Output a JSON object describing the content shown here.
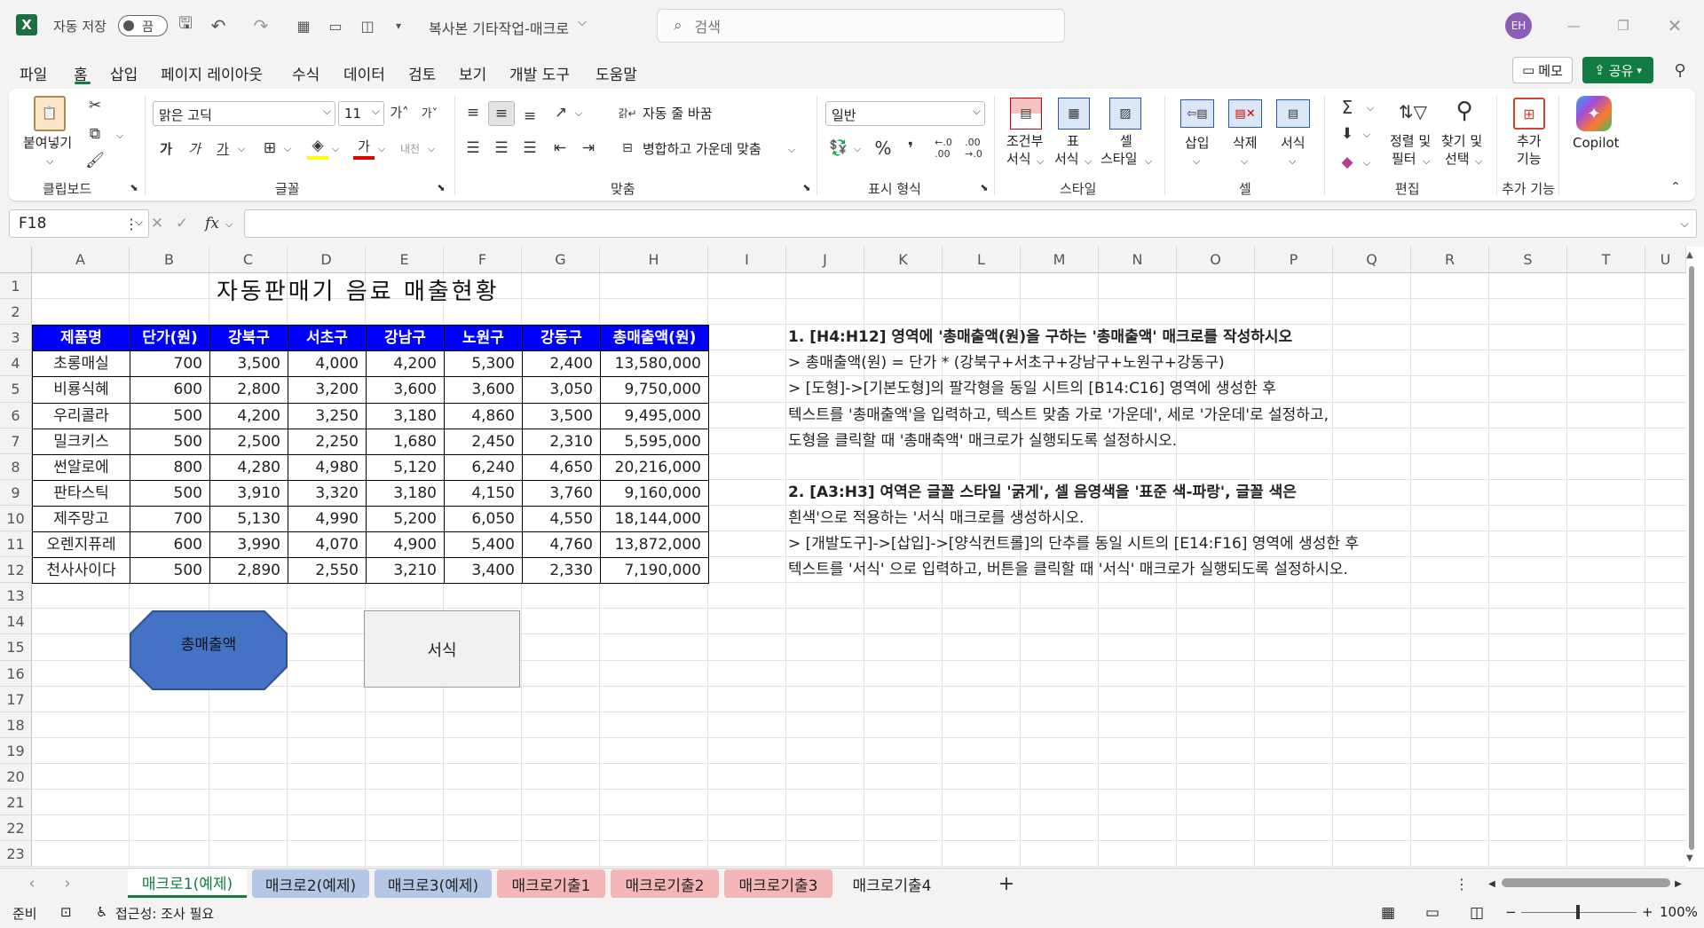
{
  "titlebar": {
    "autosave_label": "자동 저장",
    "autosave_state": "끔",
    "doc_title": "복사본 기타작업-매크로",
    "search_placeholder": "검색",
    "avatar_initials": "EH"
  },
  "menu": {
    "items": [
      "파일",
      "홈",
      "삽입",
      "페이지 레이아웃",
      "수식",
      "데이터",
      "검토",
      "보기",
      "개발 도구",
      "도움말"
    ],
    "memo_label": "메모",
    "share_label": "공유"
  },
  "ribbon": {
    "clipboard": {
      "paste": "붙여넣기",
      "group": "클립보드"
    },
    "font": {
      "name": "맑은 고딕",
      "size": "11",
      "group": "글꼴"
    },
    "align": {
      "wrap": "자동 줄 바꿈",
      "merge": "병합하고 가운데 맞춤",
      "group": "맞춤"
    },
    "number": {
      "format": "일반",
      "group": "표시 형식"
    },
    "style": {
      "cond": "조건부",
      "cond2": "서식",
      "table": "표",
      "table2": "서식",
      "cell": "셀",
      "cell2": "스타일",
      "group": "스타일"
    },
    "cells": {
      "insert": "삽입",
      "delete": "삭제",
      "format": "서식",
      "group": "셀"
    },
    "edit": {
      "sort": "정렬 및",
      "sort2": "필터",
      "find": "찾기 및",
      "find2": "선택",
      "group": "편집"
    },
    "addin": {
      "label": "추가",
      "label2": "기능",
      "group": "추가 기능"
    },
    "copilot": "Copilot"
  },
  "formula": {
    "namebox": "F18",
    "value": ""
  },
  "columns": [
    "A",
    "B",
    "C",
    "D",
    "E",
    "F",
    "G",
    "H",
    "I",
    "J",
    "K",
    "L",
    "M",
    "N",
    "O",
    "P",
    "Q",
    "R",
    "S",
    "T",
    "U"
  ],
  "rows": [
    "1",
    "2",
    "3",
    "4",
    "5",
    "6",
    "7",
    "8",
    "9",
    "10",
    "11",
    "12",
    "13",
    "14",
    "15",
    "16",
    "17",
    "18",
    "19",
    "20",
    "21",
    "22",
    "23"
  ],
  "sheet": {
    "title": "자동판매기 음료 매출현황",
    "headers": [
      "제품명",
      "단가(원)",
      "강북구",
      "서초구",
      "강남구",
      "노원구",
      "강동구",
      "총매출액(원)"
    ],
    "data": [
      [
        "초롱매실",
        "700",
        "3,500",
        "4,000",
        "4,200",
        "5,300",
        "2,400",
        "13,580,000"
      ],
      [
        "비룡식혜",
        "600",
        "2,800",
        "3,200",
        "3,600",
        "3,600",
        "3,050",
        "9,750,000"
      ],
      [
        "우리콜라",
        "500",
        "4,200",
        "3,250",
        "3,180",
        "4,860",
        "3,500",
        "9,495,000"
      ],
      [
        "밀크키스",
        "500",
        "2,500",
        "2,250",
        "1,680",
        "2,450",
        "2,310",
        "5,595,000"
      ],
      [
        "썬알로에",
        "800",
        "4,280",
        "4,980",
        "5,120",
        "6,240",
        "4,650",
        "20,216,000"
      ],
      [
        "판타스틱",
        "500",
        "3,910",
        "3,320",
        "3,180",
        "4,150",
        "3,760",
        "9,160,000"
      ],
      [
        "제주망고",
        "700",
        "5,130",
        "4,990",
        "5,200",
        "6,050",
        "4,550",
        "18,144,000"
      ],
      [
        "오렌지퓨레",
        "600",
        "3,990",
        "4,070",
        "4,900",
        "5,400",
        "4,760",
        "13,872,000"
      ],
      [
        "천사사이다",
        "500",
        "2,890",
        "2,550",
        "3,210",
        "3,400",
        "2,330",
        "7,190,000"
      ]
    ],
    "shape_label": "총매출액",
    "button_label": "서식"
  },
  "notes": [
    {
      "text": "1. [H4:H12] 영역에 '총매출액(원)을 구하는 '총매출액' 매크로를 작성하시오",
      "bold": true
    },
    {
      "text": "> 총매출액(원) = 단가 * (강북구+서초구+강남구+노원구+강동구)",
      "bold": false
    },
    {
      "text": "> [도형]->[기본도형]의 팔각형을 동일 시트의 [B14:C16] 영역에 생성한 후",
      "bold": false
    },
    {
      "text": "텍스트를 '총매출액'을 입력하고, 텍스트 맞춤 가로 '가운데', 세로 '가운데'로 설정하고,",
      "bold": false
    },
    {
      "text": "도형을 클릭할 때 '총매축액' 매크로가 실행되도록 설정하시오.",
      "bold": false
    },
    {
      "text": "",
      "bold": false
    },
    {
      "text": "2. [A3:H3] 여역은 글꼴 스타일 '굵게', 셀 음영색을 '표준 색-파랑', 글꼴 색은",
      "bold": true
    },
    {
      "text": "흰색'으로 적용하는 '서식 매크로를 생성하시오.",
      "bold": false
    },
    {
      "text": "> [개발도구]->[삽입]->[양식컨트롤]의 단추를 동일 시트의 [E14:F16] 영역에 생성한 후",
      "bold": false
    },
    {
      "text": "텍스트를 '서식' 으로 입력하고, 버튼을 클릭할 때 '서식' 매크로가 실행되도록 설정하시오.",
      "bold": false
    }
  ],
  "tabs": [
    {
      "label": "매크로1(예제)",
      "color": "#ffffff"
    },
    {
      "label": "매크로2(예제)",
      "color": "#b4c7e7"
    },
    {
      "label": "매크로3(예제)",
      "color": "#b4c7e7"
    },
    {
      "label": "매크로기출1",
      "color": "#f4b6b6"
    },
    {
      "label": "매크로기출2",
      "color": "#f4b6b6"
    },
    {
      "label": "매크로기출3",
      "color": "#f4b6b6"
    },
    {
      "label": "매크로기출4",
      "color": "#f3f3f3"
    }
  ],
  "status": {
    "ready": "준비",
    "accessibility": "접근성: 조사 필요",
    "zoom": "100%"
  },
  "colors": {
    "header_fill": "#0000ff",
    "shape_fill": "#4472c4",
    "excel_green": "#1d6f42",
    "accent": "#107c41"
  }
}
